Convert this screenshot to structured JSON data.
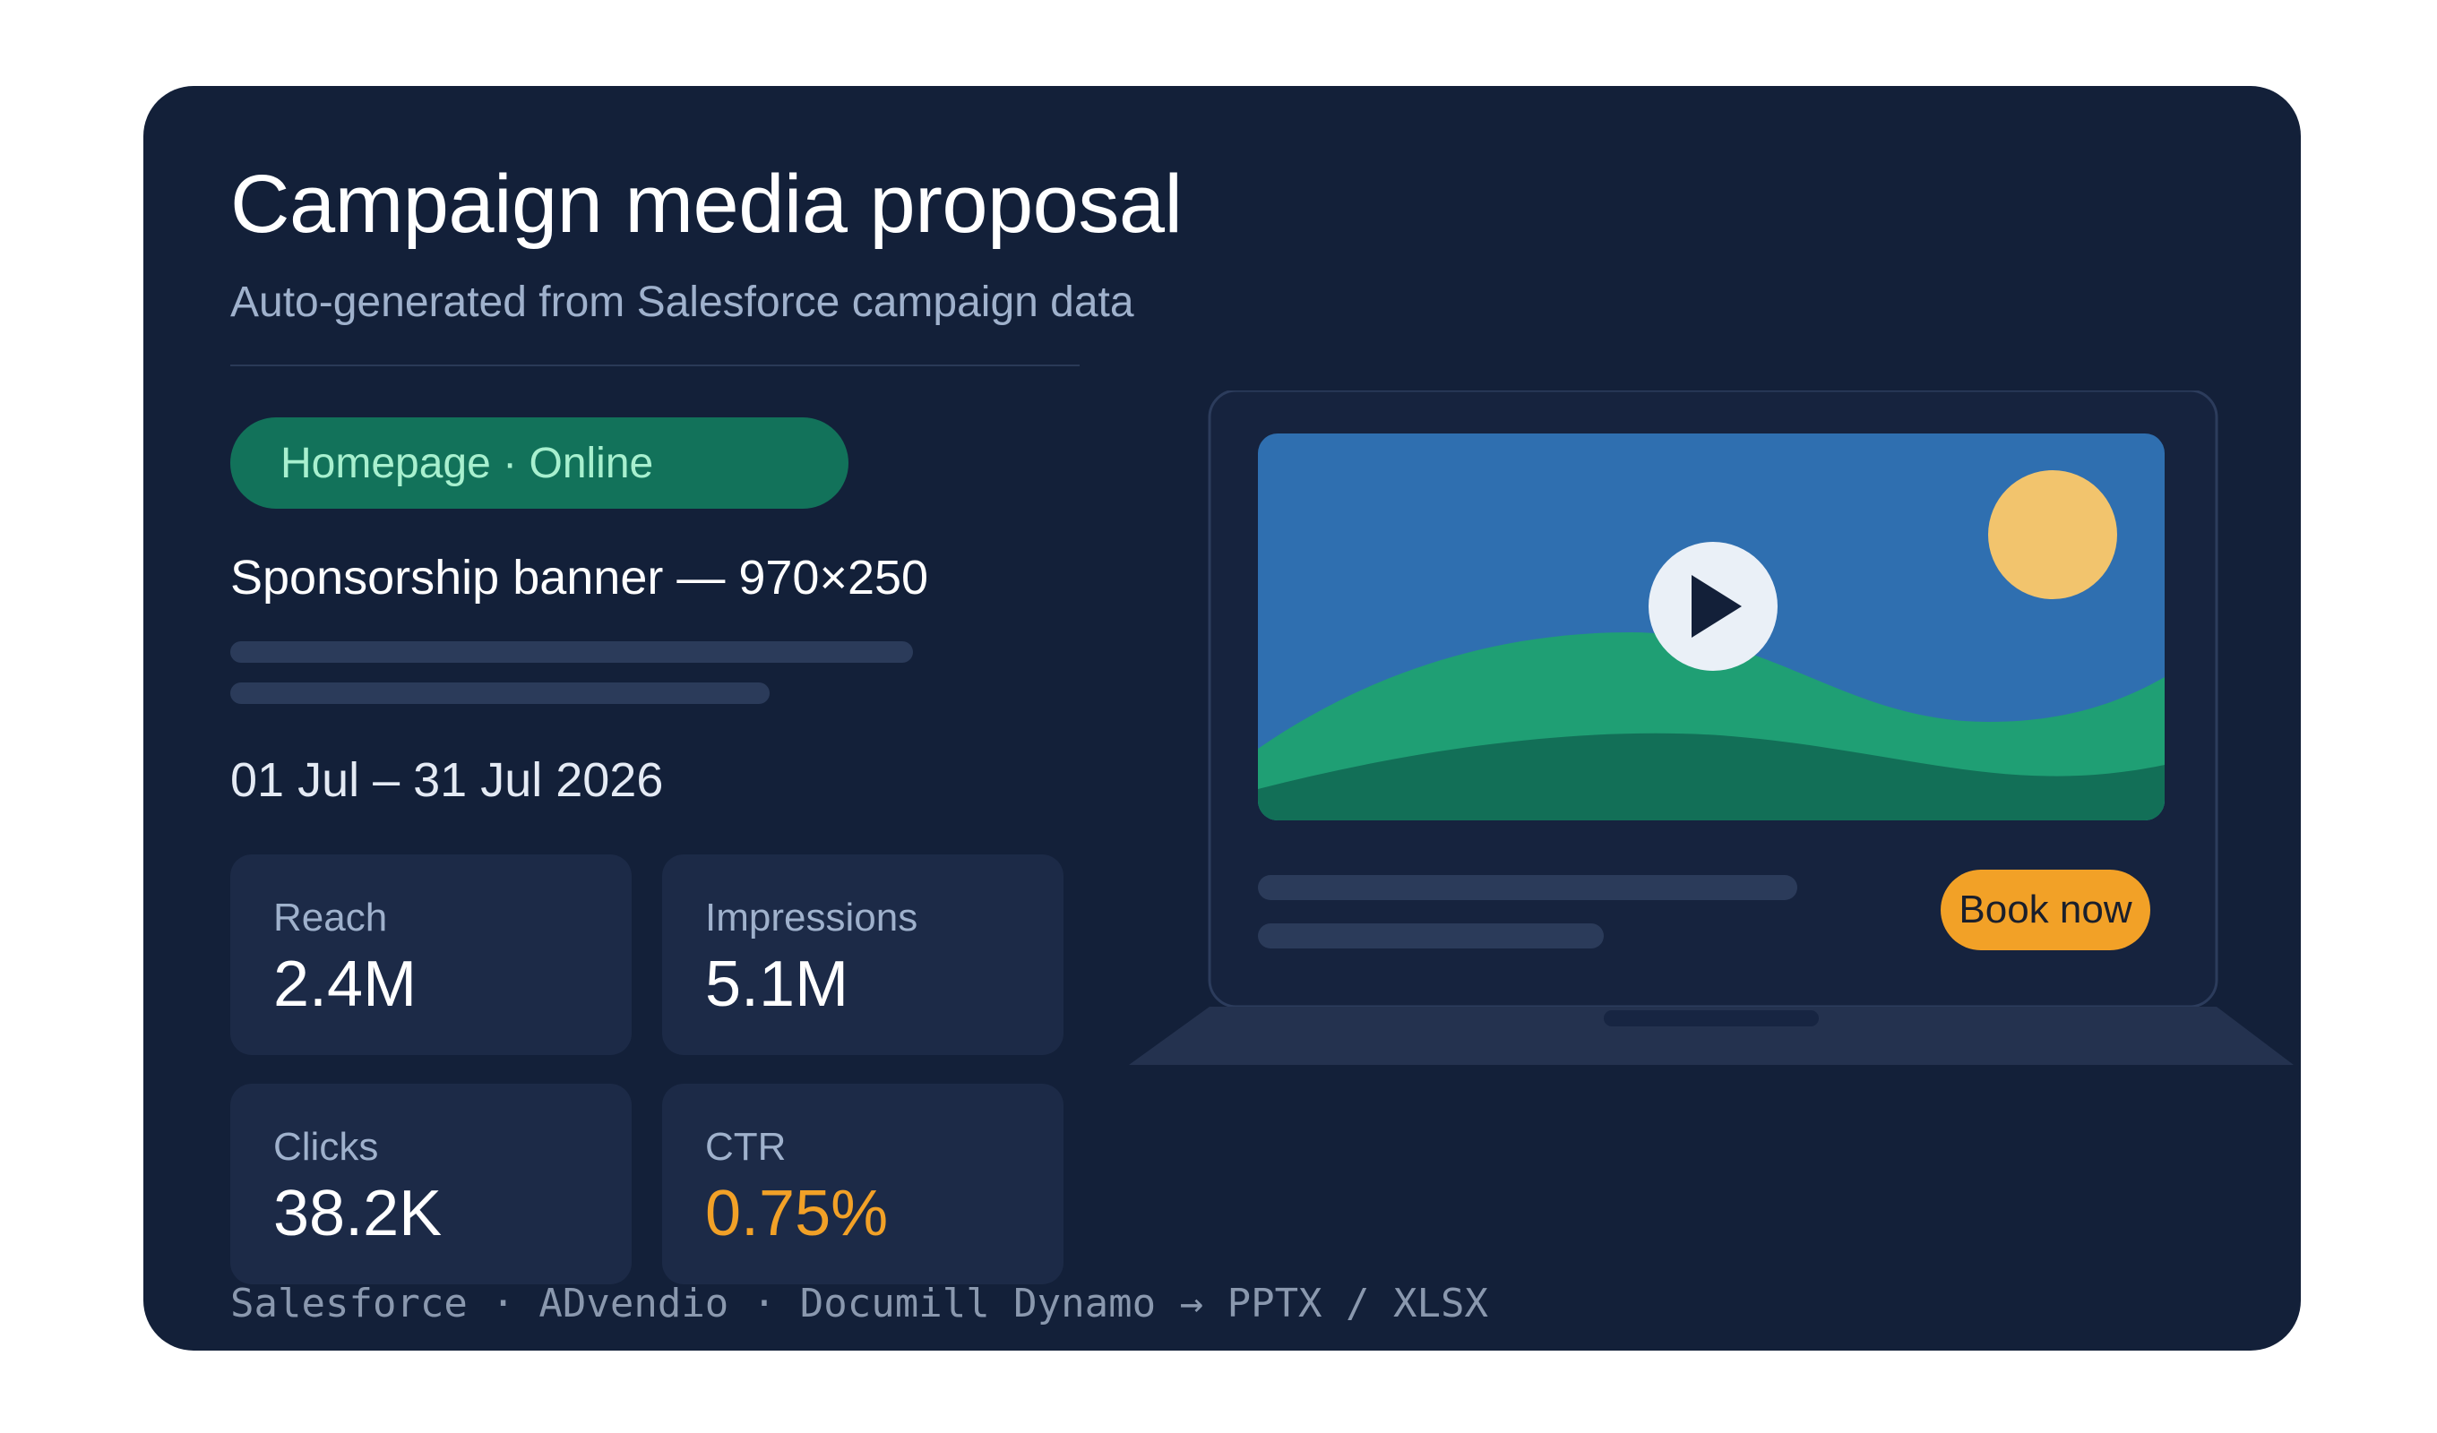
{
  "proposal": {
    "title": "Campaign media proposal",
    "subtitle": "Auto-generated from Salesforce campaign data",
    "placement_tag": "Homepage · Online",
    "banner_title": "Sponsorship banner — 970×250",
    "dates": "01 Jul – 31 Jul 2026"
  },
  "metrics": [
    {
      "label": "Reach",
      "value": "2.4M"
    },
    {
      "label": "Impressions",
      "value": "5.1M"
    },
    {
      "label": "Clicks",
      "value": "38.2K"
    },
    {
      "label": "CTR",
      "value": "0.75%"
    }
  ],
  "preview": {
    "cta_label": "Book now",
    "icons": [
      "play-icon",
      "sun-icon",
      "hills-icon",
      "laptop-icon"
    ]
  },
  "footer": "Salesforce · ADvendio · Documill Dynamo → PPTX / XLSX",
  "colors": {
    "background": "#132039",
    "accent": "#f2a127",
    "tag_bg": "#12725a",
    "tag_text": "#a8f0cf",
    "metric_card": "#1c2a47",
    "video_sky": "#2f6fb0",
    "sun": "#f2c46d",
    "hill_light": "#1f9f74",
    "hill_dark": "#126f57"
  }
}
